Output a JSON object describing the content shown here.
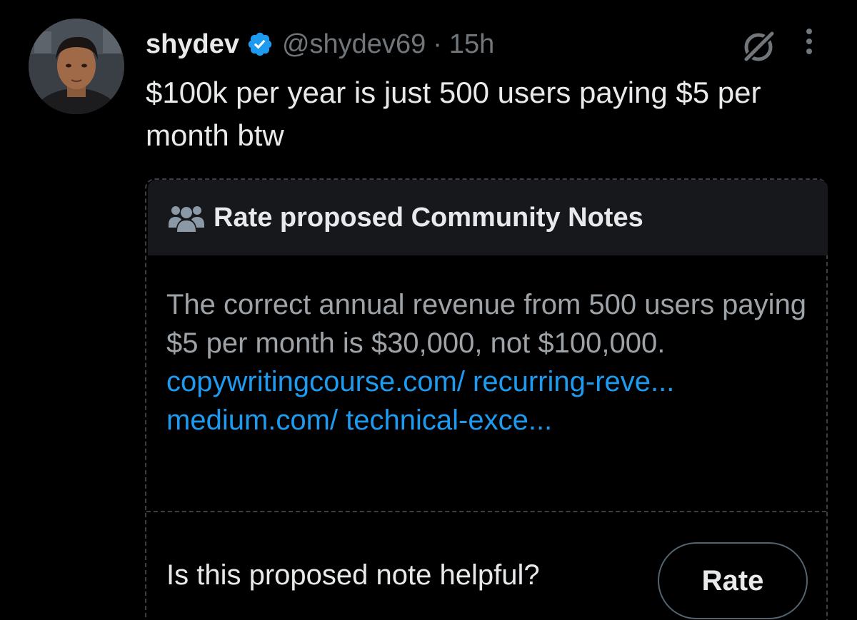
{
  "tweet": {
    "display_name": "shydev",
    "handle": "@shydev69",
    "separator": "·",
    "time": "15h",
    "text": "$100k per year is just 500 users paying $5 per month btw"
  },
  "icons": {
    "verified": "verified-badge-icon",
    "grok": "grok-icon",
    "more": "more-vertical-icon",
    "people": "people-icon"
  },
  "community_note": {
    "title": "Rate proposed Community Notes",
    "body_text": "The correct annual revenue from 500 users paying $5 per month is $30,000, not $100,000. ",
    "link_1": "copywritingcourse.com/ recurring-reve...",
    "link_2": "medium.com/ technical-exce...",
    "question": "Is this proposed note helpful?",
    "rate_label": "Rate"
  },
  "colors": {
    "background": "#000000",
    "primary_text": "#e7e9ea",
    "secondary_text": "#71767b",
    "link": "#1d9bf0",
    "verified": "#1d9bf0",
    "note_header_bg": "#16181c"
  }
}
